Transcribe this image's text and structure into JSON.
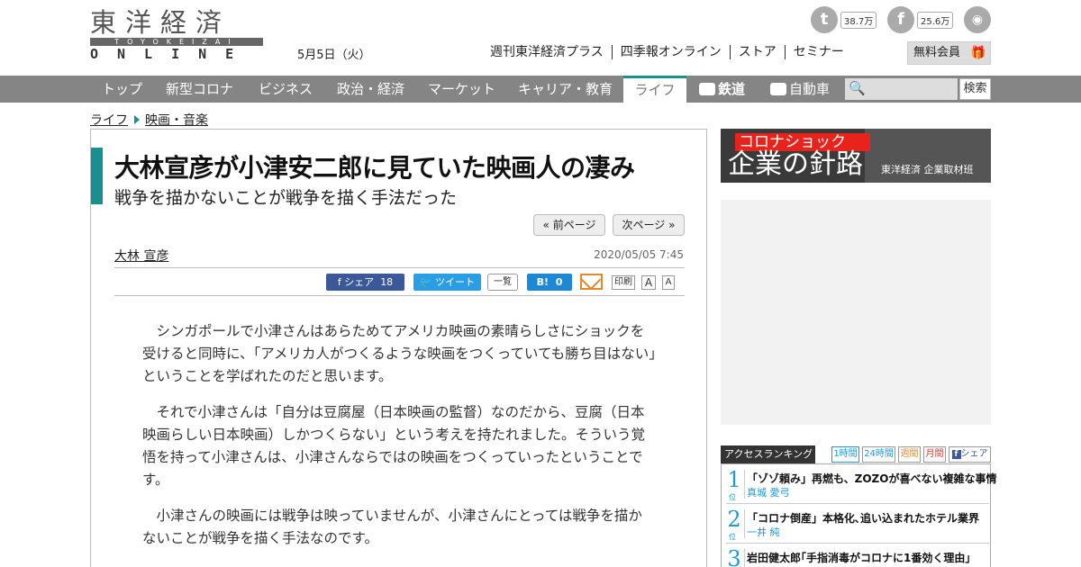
{
  "header": {
    "logo_jp": "東洋経済",
    "logo_roman": "TOYOKEIZAI",
    "logo_online": "ONLINE",
    "date": "5月5日（火）",
    "links": [
      "週刊東洋経済プラス",
      "四季報オンライン",
      "ストア",
      "セミナー"
    ],
    "member_button": "無料会員",
    "social": [
      {
        "name": "twitter",
        "glyph": "t",
        "count": "38.7万"
      },
      {
        "name": "facebook",
        "glyph": "f",
        "count": "25.6万"
      },
      {
        "name": "rss",
        "glyph": "◉",
        "count": ""
      }
    ]
  },
  "nav": {
    "categories": [
      "トップ",
      "新型コロナ",
      "ビジネス",
      "政治・経済",
      "マーケット",
      "キャリア・教育",
      "ライフ",
      "鉄道",
      "自動車"
    ],
    "active": "ライフ",
    "search_placeholder": "",
    "search_button": "検索"
  },
  "breadcrumb": [
    "ライフ",
    "映画・音楽"
  ],
  "article": {
    "title": "大林宣彦が小津安二郎に見ていた映画人の凄み",
    "subtitle": "戦争を描かないことが戦争を描く手法だった",
    "prev_page": "« 前ページ",
    "next_page": "次ページ »",
    "author": "大林 宣彦",
    "published": "2020/05/05 7:45",
    "share": {
      "facebook": "シェア",
      "facebook_count": "18",
      "twitter": "ツイート",
      "list": "一覧",
      "hatena": "B!",
      "hatena_count": "0",
      "print": "印刷",
      "font_small": "A",
      "font_large": "A"
    },
    "paragraphs": [
      "シンガポールで小津さんはあらためてアメリカ映画の素晴らしさにショックを受けると同時に、「アメリカ人がつくるような映画をつくっていても勝ち目はない」ということを学ばれたのだと思います。",
      "それで小津さんは「自分は豆腐屋（日本映画の監督）なのだから、豆腐（日本映画らしい日本映画）しかつくらない」という考えを持たれました。そういう覚悟を持って小津さんは、小津さんならではの映画をつくっていったということです。",
      "小津さんの映画には戦争は映っていませんが、小津さんにとっては戦争を描かないことが戦争を描く手法なのです。"
    ]
  },
  "sidebar": {
    "banner": {
      "red_text": "コロナショック",
      "main_text": "企業の針路",
      "sub_text": "東洋経済 企業取材班"
    },
    "ranking": {
      "title": "アクセスランキング",
      "tabs": [
        "1時間",
        "24時間",
        "週間",
        "月間",
        "シェア"
      ],
      "position_label": "位",
      "items": [
        {
          "rank": "1",
          "headline": "「ゾゾ頼み」再燃も、ZOZOが喜べない複雑な事情",
          "author": "真城 愛弓"
        },
        {
          "rank": "2",
          "headline": "「コロナ倒産」本格化､追い込まれたホテル業界",
          "author": "一井 純"
        },
        {
          "rank": "3",
          "headline": "岩田健太郎｢手指消毒がコロナに1番効く理由｣",
          "author": ""
        }
      ]
    }
  },
  "colors": {
    "accent": "#19908f",
    "nav_bg": "#858585",
    "facebook": "#3b5998",
    "twitter": "#2a9ee5",
    "hatena": "#1e88d4",
    "ranking_blue": "#1b9ad6",
    "banner_red": "#e8231c"
  }
}
